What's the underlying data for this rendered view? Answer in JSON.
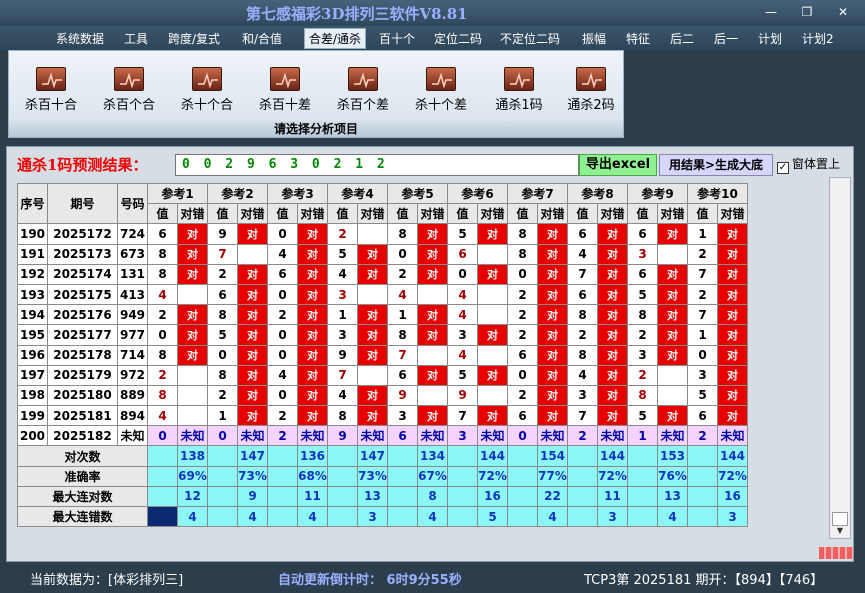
{
  "app": {
    "title": "第七感福彩3D排列三软件V8.81",
    "window_buttons": [
      "—",
      "❐",
      "✕"
    ]
  },
  "menu": [
    "系统数据",
    "工具",
    "跨度/复式",
    "和/合值",
    "合差/通杀",
    "百十个",
    "定位二码",
    "不定位二码",
    "振幅",
    "特征",
    "后二",
    "后一",
    "计划",
    "计划2"
  ],
  "menu_active": 4,
  "ribbon": {
    "buttons": [
      "杀百十合",
      "杀百个合",
      "杀十个合",
      "杀百十差",
      "杀百个差",
      "杀十个差",
      "通杀1码",
      "通杀2码"
    ],
    "caption": "请选择分析项目"
  },
  "prediction": {
    "label": "通杀1码预测结果：",
    "value": "0 0 2 9 6 3 0 2 1 2",
    "export_label": "导出excel",
    "bigroll_label": "用结果>生成大底",
    "topmost_label": "窗体置上",
    "topmost_checked": "✓"
  },
  "table": {
    "col_headers": [
      "序号",
      "期号",
      "号码"
    ],
    "ref_headers": [
      "参考1",
      "参考2",
      "参考3",
      "参考4",
      "参考5",
      "参考6",
      "参考7",
      "参考8",
      "参考9",
      "参考10"
    ],
    "sub_value": "值",
    "sub_right": "对错",
    "hit_mark": "对",
    "rows": [
      {
        "seq": "190",
        "period": "2025172",
        "num": "724",
        "refs": [
          [
            "6",
            1
          ],
          [
            "9",
            1
          ],
          [
            "0",
            1
          ],
          [
            "2",
            0
          ],
          [
            "8",
            1
          ],
          [
            "5",
            1
          ],
          [
            "8",
            1
          ],
          [
            "6",
            1
          ],
          [
            "6",
            1
          ],
          [
            "1",
            1
          ]
        ]
      },
      {
        "seq": "191",
        "period": "2025173",
        "num": "673",
        "refs": [
          [
            "8",
            1
          ],
          [
            "7",
            0
          ],
          [
            "4",
            1
          ],
          [
            "5",
            1
          ],
          [
            "0",
            1
          ],
          [
            "6",
            0
          ],
          [
            "8",
            1
          ],
          [
            "4",
            1
          ],
          [
            "3",
            0
          ],
          [
            "2",
            1
          ]
        ]
      },
      {
        "seq": "192",
        "period": "2025174",
        "num": "131",
        "refs": [
          [
            "8",
            1
          ],
          [
            "2",
            1
          ],
          [
            "6",
            1
          ],
          [
            "4",
            1
          ],
          [
            "2",
            1
          ],
          [
            "0",
            1
          ],
          [
            "0",
            1
          ],
          [
            "7",
            1
          ],
          [
            "6",
            1
          ],
          [
            "7",
            1
          ]
        ]
      },
      {
        "seq": "193",
        "period": "2025175",
        "num": "413",
        "refs": [
          [
            "4",
            0
          ],
          [
            "6",
            1
          ],
          [
            "0",
            1
          ],
          [
            "3",
            0
          ],
          [
            "4",
            0
          ],
          [
            "4",
            0
          ],
          [
            "2",
            1
          ],
          [
            "6",
            1
          ],
          [
            "5",
            1
          ],
          [
            "2",
            1
          ]
        ]
      },
      {
        "seq": "194",
        "period": "2025176",
        "num": "949",
        "refs": [
          [
            "2",
            1
          ],
          [
            "8",
            1
          ],
          [
            "2",
            1
          ],
          [
            "1",
            1
          ],
          [
            "1",
            1
          ],
          [
            "4",
            0
          ],
          [
            "2",
            1
          ],
          [
            "8",
            1
          ],
          [
            "8",
            1
          ],
          [
            "7",
            1
          ]
        ]
      },
      {
        "seq": "195",
        "period": "2025177",
        "num": "977",
        "refs": [
          [
            "0",
            1
          ],
          [
            "5",
            1
          ],
          [
            "0",
            1
          ],
          [
            "3",
            1
          ],
          [
            "8",
            1
          ],
          [
            "3",
            1
          ],
          [
            "2",
            1
          ],
          [
            "2",
            1
          ],
          [
            "2",
            1
          ],
          [
            "1",
            1
          ]
        ]
      },
      {
        "seq": "196",
        "period": "2025178",
        "num": "714",
        "refs": [
          [
            "8",
            1
          ],
          [
            "0",
            1
          ],
          [
            "0",
            1
          ],
          [
            "9",
            1
          ],
          [
            "7",
            0
          ],
          [
            "4",
            0
          ],
          [
            "6",
            1
          ],
          [
            "8",
            1
          ],
          [
            "3",
            1
          ],
          [
            "0",
            1
          ]
        ]
      },
      {
        "seq": "197",
        "period": "2025179",
        "num": "972",
        "refs": [
          [
            "2",
            0
          ],
          [
            "8",
            1
          ],
          [
            "4",
            1
          ],
          [
            "7",
            0
          ],
          [
            "6",
            1
          ],
          [
            "5",
            1
          ],
          [
            "0",
            1
          ],
          [
            "4",
            1
          ],
          [
            "2",
            0
          ],
          [
            "3",
            1
          ]
        ]
      },
      {
        "seq": "198",
        "period": "2025180",
        "num": "889",
        "refs": [
          [
            "8",
            0
          ],
          [
            "2",
            1
          ],
          [
            "0",
            1
          ],
          [
            "4",
            1
          ],
          [
            "9",
            0
          ],
          [
            "9",
            0
          ],
          [
            "2",
            1
          ],
          [
            "3",
            1
          ],
          [
            "8",
            0
          ],
          [
            "5",
            1
          ]
        ]
      },
      {
        "seq": "199",
        "period": "2025181",
        "num": "894",
        "refs": [
          [
            "4",
            0
          ],
          [
            "1",
            1
          ],
          [
            "2",
            1
          ],
          [
            "8",
            1
          ],
          [
            "3",
            1
          ],
          [
            "7",
            1
          ],
          [
            "6",
            1
          ],
          [
            "7",
            1
          ],
          [
            "5",
            1
          ],
          [
            "6",
            1
          ]
        ]
      }
    ],
    "pending_row": {
      "seq": "200",
      "period": "2025182",
      "num": "未知",
      "values": [
        "0",
        "0",
        "2",
        "9",
        "6",
        "3",
        "0",
        "2",
        "1",
        "2"
      ],
      "status": "未知"
    },
    "stats": [
      {
        "label": "对次数",
        "values": [
          "138",
          "147",
          "136",
          "147",
          "134",
          "144",
          "154",
          "144",
          "153",
          "144"
        ]
      },
      {
        "label": "准确率",
        "values": [
          "69%",
          "73%",
          "68%",
          "73%",
          "67%",
          "72%",
          "77%",
          "72%",
          "76%",
          "72%"
        ]
      },
      {
        "label": "最大连对数",
        "values": [
          "12",
          "9",
          "11",
          "13",
          "8",
          "16",
          "22",
          "11",
          "13",
          "16"
        ]
      },
      {
        "label": "最大连错数",
        "values": [
          "4",
          "4",
          "4",
          "3",
          "4",
          "5",
          "4",
          "3",
          "4",
          "3"
        ]
      }
    ]
  },
  "status": {
    "data_source": "当前数据为：[体彩排列三]",
    "countdown": "自动更新倒计时：  6时9分55秒",
    "draw_info": "TCP3第 2025181 期开：【894】【746】"
  },
  "colors": {
    "hit": "#e60000",
    "pending": "#f4d4ff",
    "stats": "#8cf7f5",
    "title": "#9ab0ff"
  }
}
